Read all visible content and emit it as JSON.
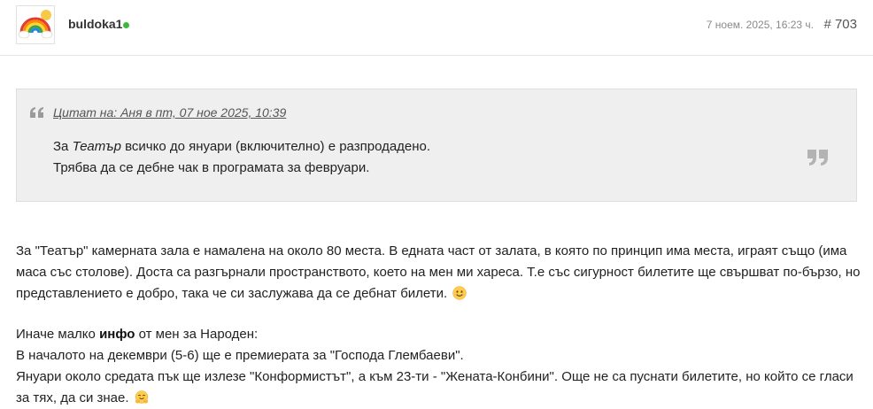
{
  "header": {
    "username": "buldoka1",
    "date": "7 ноем. 2025, 16:23 ч.",
    "post_number": "# 703"
  },
  "quote": {
    "cite": "Цитат на: Аня в пт, 07 ное 2025, 10:39",
    "line1_before": "За ",
    "line1_italic": "Театър",
    "line1_after": " всичко до януари (включително) е разпродадено.",
    "line2": "Трябва да се дебне чак в програмата за февруари."
  },
  "body": {
    "para1": "За \"Театър\" камерната зала е намалена на около 80 места.  В едната част от залата, в която по принцип има места, играят също (има маса със столове). Доста са разгърнали пространството, което на мен ми хареса. Т.е със сигурност билетите ще свършват по-бързо, но представлението е добро, така че си заслужава да се дебнат билети.",
    "para2_lead": "Иначе малко ",
    "para2_bold": "инфо",
    "para2_after": " от мен за Народен:",
    "para2_line2": "В началото на декември (5-6) ще е премиерата за \"Господа Глембаеви\".",
    "para2_line3": "Януари около средата пък ще излезе \"Конформистът\", а към 23-ти - \"Жената-Конбини\". Още не са пуснати билетите, но който се гласи за тях, да си знае."
  },
  "colors": {
    "online": "#3cb83c",
    "quote_bg": "#efefef",
    "quote_icon": "#9a9a9a"
  },
  "icons": {
    "avatar": "rainbow-cloud-avatar",
    "quote_open": "quote-open-icon",
    "quote_close": "quote-close-icon",
    "emoji1": "smiling-face-icon",
    "emoji2": "hugging-face-icon"
  }
}
